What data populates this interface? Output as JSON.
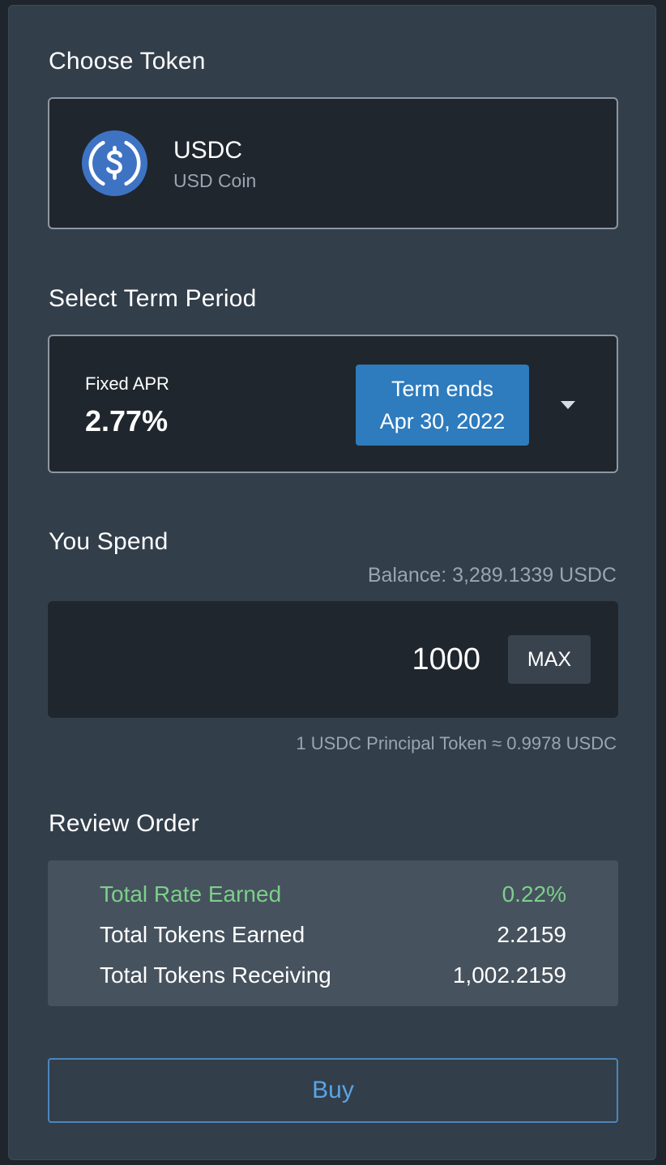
{
  "token_section": {
    "title": "Choose Token",
    "symbol": "USDC",
    "name": "USD Coin",
    "icon": "usdc-coin-icon",
    "icon_color": "#3e73c4"
  },
  "term_section": {
    "title": "Select Term Period",
    "apr_label": "Fixed APR",
    "apr_value": "2.77%",
    "term_label": "Term ends",
    "term_date": "Apr 30, 2022",
    "dropdown_icon": "caret-down-icon",
    "accent": "#2e7bbd"
  },
  "spend_section": {
    "title": "You Spend",
    "balance": "Balance: 3,289.1339 USDC",
    "amount": "1000",
    "max_label": "MAX",
    "conversion_note": "1 USDC Principal Token ≈ 0.9978 USDC"
  },
  "review_section": {
    "title": "Review Order",
    "rows": [
      {
        "label": "Total Rate Earned",
        "value": "0.22%"
      },
      {
        "label": "Total Tokens Earned",
        "value": "2.2159"
      },
      {
        "label": "Total Tokens Receiving",
        "value": "1,002.2159"
      }
    ],
    "highlight_color": "#7ccf8a"
  },
  "buy_label": "Buy"
}
